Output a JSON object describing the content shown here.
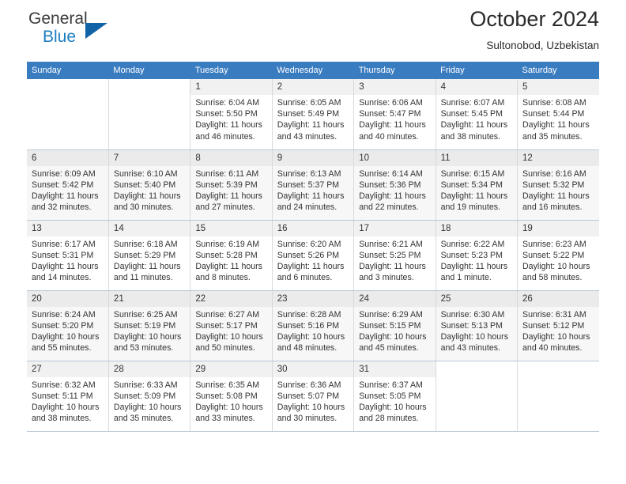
{
  "brand": {
    "name_part1": "General",
    "name_part2": "Blue",
    "accent_color": "#1163a8",
    "text_color": "#3c3c3c"
  },
  "header": {
    "title": "October 2024",
    "location": "Sultonobod, Uzbekistan"
  },
  "theme": {
    "header_row_bg": "#3a7cc0",
    "header_row_text": "#ffffff",
    "row_shade_bg": "#f7f7f7",
    "daynum_bg": "#eeeeee",
    "grid_line": "#b9c7d6"
  },
  "calendar": {
    "weekday_headers": [
      "Sunday",
      "Monday",
      "Tuesday",
      "Wednesday",
      "Thursday",
      "Friday",
      "Saturday"
    ],
    "labels": {
      "sunrise": "Sunrise:",
      "sunset": "Sunset:",
      "daylight": "Daylight:"
    },
    "weeks": [
      [
        {
          "day": "",
          "sunrise": "",
          "sunset": "",
          "daylight_line1": "",
          "daylight_line2": ""
        },
        {
          "day": "",
          "sunrise": "",
          "sunset": "",
          "daylight_line1": "",
          "daylight_line2": ""
        },
        {
          "day": "1",
          "sunrise": "Sunrise: 6:04 AM",
          "sunset": "Sunset: 5:50 PM",
          "daylight_line1": "Daylight: 11 hours",
          "daylight_line2": "and 46 minutes."
        },
        {
          "day": "2",
          "sunrise": "Sunrise: 6:05 AM",
          "sunset": "Sunset: 5:49 PM",
          "daylight_line1": "Daylight: 11 hours",
          "daylight_line2": "and 43 minutes."
        },
        {
          "day": "3",
          "sunrise": "Sunrise: 6:06 AM",
          "sunset": "Sunset: 5:47 PM",
          "daylight_line1": "Daylight: 11 hours",
          "daylight_line2": "and 40 minutes."
        },
        {
          "day": "4",
          "sunrise": "Sunrise: 6:07 AM",
          "sunset": "Sunset: 5:45 PM",
          "daylight_line1": "Daylight: 11 hours",
          "daylight_line2": "and 38 minutes."
        },
        {
          "day": "5",
          "sunrise": "Sunrise: 6:08 AM",
          "sunset": "Sunset: 5:44 PM",
          "daylight_line1": "Daylight: 11 hours",
          "daylight_line2": "and 35 minutes."
        }
      ],
      [
        {
          "day": "6",
          "sunrise": "Sunrise: 6:09 AM",
          "sunset": "Sunset: 5:42 PM",
          "daylight_line1": "Daylight: 11 hours",
          "daylight_line2": "and 32 minutes."
        },
        {
          "day": "7",
          "sunrise": "Sunrise: 6:10 AM",
          "sunset": "Sunset: 5:40 PM",
          "daylight_line1": "Daylight: 11 hours",
          "daylight_line2": "and 30 minutes."
        },
        {
          "day": "8",
          "sunrise": "Sunrise: 6:11 AM",
          "sunset": "Sunset: 5:39 PM",
          "daylight_line1": "Daylight: 11 hours",
          "daylight_line2": "and 27 minutes."
        },
        {
          "day": "9",
          "sunrise": "Sunrise: 6:13 AM",
          "sunset": "Sunset: 5:37 PM",
          "daylight_line1": "Daylight: 11 hours",
          "daylight_line2": "and 24 minutes."
        },
        {
          "day": "10",
          "sunrise": "Sunrise: 6:14 AM",
          "sunset": "Sunset: 5:36 PM",
          "daylight_line1": "Daylight: 11 hours",
          "daylight_line2": "and 22 minutes."
        },
        {
          "day": "11",
          "sunrise": "Sunrise: 6:15 AM",
          "sunset": "Sunset: 5:34 PM",
          "daylight_line1": "Daylight: 11 hours",
          "daylight_line2": "and 19 minutes."
        },
        {
          "day": "12",
          "sunrise": "Sunrise: 6:16 AM",
          "sunset": "Sunset: 5:32 PM",
          "daylight_line1": "Daylight: 11 hours",
          "daylight_line2": "and 16 minutes."
        }
      ],
      [
        {
          "day": "13",
          "sunrise": "Sunrise: 6:17 AM",
          "sunset": "Sunset: 5:31 PM",
          "daylight_line1": "Daylight: 11 hours",
          "daylight_line2": "and 14 minutes."
        },
        {
          "day": "14",
          "sunrise": "Sunrise: 6:18 AM",
          "sunset": "Sunset: 5:29 PM",
          "daylight_line1": "Daylight: 11 hours",
          "daylight_line2": "and 11 minutes."
        },
        {
          "day": "15",
          "sunrise": "Sunrise: 6:19 AM",
          "sunset": "Sunset: 5:28 PM",
          "daylight_line1": "Daylight: 11 hours",
          "daylight_line2": "and 8 minutes."
        },
        {
          "day": "16",
          "sunrise": "Sunrise: 6:20 AM",
          "sunset": "Sunset: 5:26 PM",
          "daylight_line1": "Daylight: 11 hours",
          "daylight_line2": "and 6 minutes."
        },
        {
          "day": "17",
          "sunrise": "Sunrise: 6:21 AM",
          "sunset": "Sunset: 5:25 PM",
          "daylight_line1": "Daylight: 11 hours",
          "daylight_line2": "and 3 minutes."
        },
        {
          "day": "18",
          "sunrise": "Sunrise: 6:22 AM",
          "sunset": "Sunset: 5:23 PM",
          "daylight_line1": "Daylight: 11 hours",
          "daylight_line2": "and 1 minute."
        },
        {
          "day": "19",
          "sunrise": "Sunrise: 6:23 AM",
          "sunset": "Sunset: 5:22 PM",
          "daylight_line1": "Daylight: 10 hours",
          "daylight_line2": "and 58 minutes."
        }
      ],
      [
        {
          "day": "20",
          "sunrise": "Sunrise: 6:24 AM",
          "sunset": "Sunset: 5:20 PM",
          "daylight_line1": "Daylight: 10 hours",
          "daylight_line2": "and 55 minutes."
        },
        {
          "day": "21",
          "sunrise": "Sunrise: 6:25 AM",
          "sunset": "Sunset: 5:19 PM",
          "daylight_line1": "Daylight: 10 hours",
          "daylight_line2": "and 53 minutes."
        },
        {
          "day": "22",
          "sunrise": "Sunrise: 6:27 AM",
          "sunset": "Sunset: 5:17 PM",
          "daylight_line1": "Daylight: 10 hours",
          "daylight_line2": "and 50 minutes."
        },
        {
          "day": "23",
          "sunrise": "Sunrise: 6:28 AM",
          "sunset": "Sunset: 5:16 PM",
          "daylight_line1": "Daylight: 10 hours",
          "daylight_line2": "and 48 minutes."
        },
        {
          "day": "24",
          "sunrise": "Sunrise: 6:29 AM",
          "sunset": "Sunset: 5:15 PM",
          "daylight_line1": "Daylight: 10 hours",
          "daylight_line2": "and 45 minutes."
        },
        {
          "day": "25",
          "sunrise": "Sunrise: 6:30 AM",
          "sunset": "Sunset: 5:13 PM",
          "daylight_line1": "Daylight: 10 hours",
          "daylight_line2": "and 43 minutes."
        },
        {
          "day": "26",
          "sunrise": "Sunrise: 6:31 AM",
          "sunset": "Sunset: 5:12 PM",
          "daylight_line1": "Daylight: 10 hours",
          "daylight_line2": "and 40 minutes."
        }
      ],
      [
        {
          "day": "27",
          "sunrise": "Sunrise: 6:32 AM",
          "sunset": "Sunset: 5:11 PM",
          "daylight_line1": "Daylight: 10 hours",
          "daylight_line2": "and 38 minutes."
        },
        {
          "day": "28",
          "sunrise": "Sunrise: 6:33 AM",
          "sunset": "Sunset: 5:09 PM",
          "daylight_line1": "Daylight: 10 hours",
          "daylight_line2": "and 35 minutes."
        },
        {
          "day": "29",
          "sunrise": "Sunrise: 6:35 AM",
          "sunset": "Sunset: 5:08 PM",
          "daylight_line1": "Daylight: 10 hours",
          "daylight_line2": "and 33 minutes."
        },
        {
          "day": "30",
          "sunrise": "Sunrise: 6:36 AM",
          "sunset": "Sunset: 5:07 PM",
          "daylight_line1": "Daylight: 10 hours",
          "daylight_line2": "and 30 minutes."
        },
        {
          "day": "31",
          "sunrise": "Sunrise: 6:37 AM",
          "sunset": "Sunset: 5:05 PM",
          "daylight_line1": "Daylight: 10 hours",
          "daylight_line2": "and 28 minutes."
        },
        {
          "day": "",
          "sunrise": "",
          "sunset": "",
          "daylight_line1": "",
          "daylight_line2": ""
        },
        {
          "day": "",
          "sunrise": "",
          "sunset": "",
          "daylight_line1": "",
          "daylight_line2": ""
        }
      ]
    ]
  }
}
